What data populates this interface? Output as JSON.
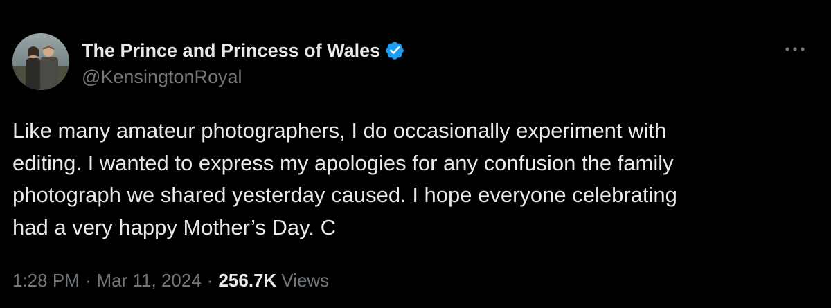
{
  "tweet": {
    "display_name": "The Prince and Princess of Wales",
    "handle": "@KensingtonRoyal",
    "verified_icon": "verified-badge-icon",
    "more_icon": "more-options-icon",
    "text": "Like many amateur photographers, I do occasionally experiment with\nediting. I wanted to express my apologies for any confusion the family\nphotograph we shared yesterday caused. I hope everyone celebrating\nhad a very happy Mother’s Day. C",
    "time": "1:28 PM",
    "date": "Mar 11, 2024",
    "separator": "·",
    "views_count": "256.7K",
    "views_label": "Views"
  },
  "colors": {
    "background": "#000000",
    "primary_text": "#e7e9ea",
    "secondary_text": "#71767b",
    "verified_blue": "#1d9bf0"
  }
}
